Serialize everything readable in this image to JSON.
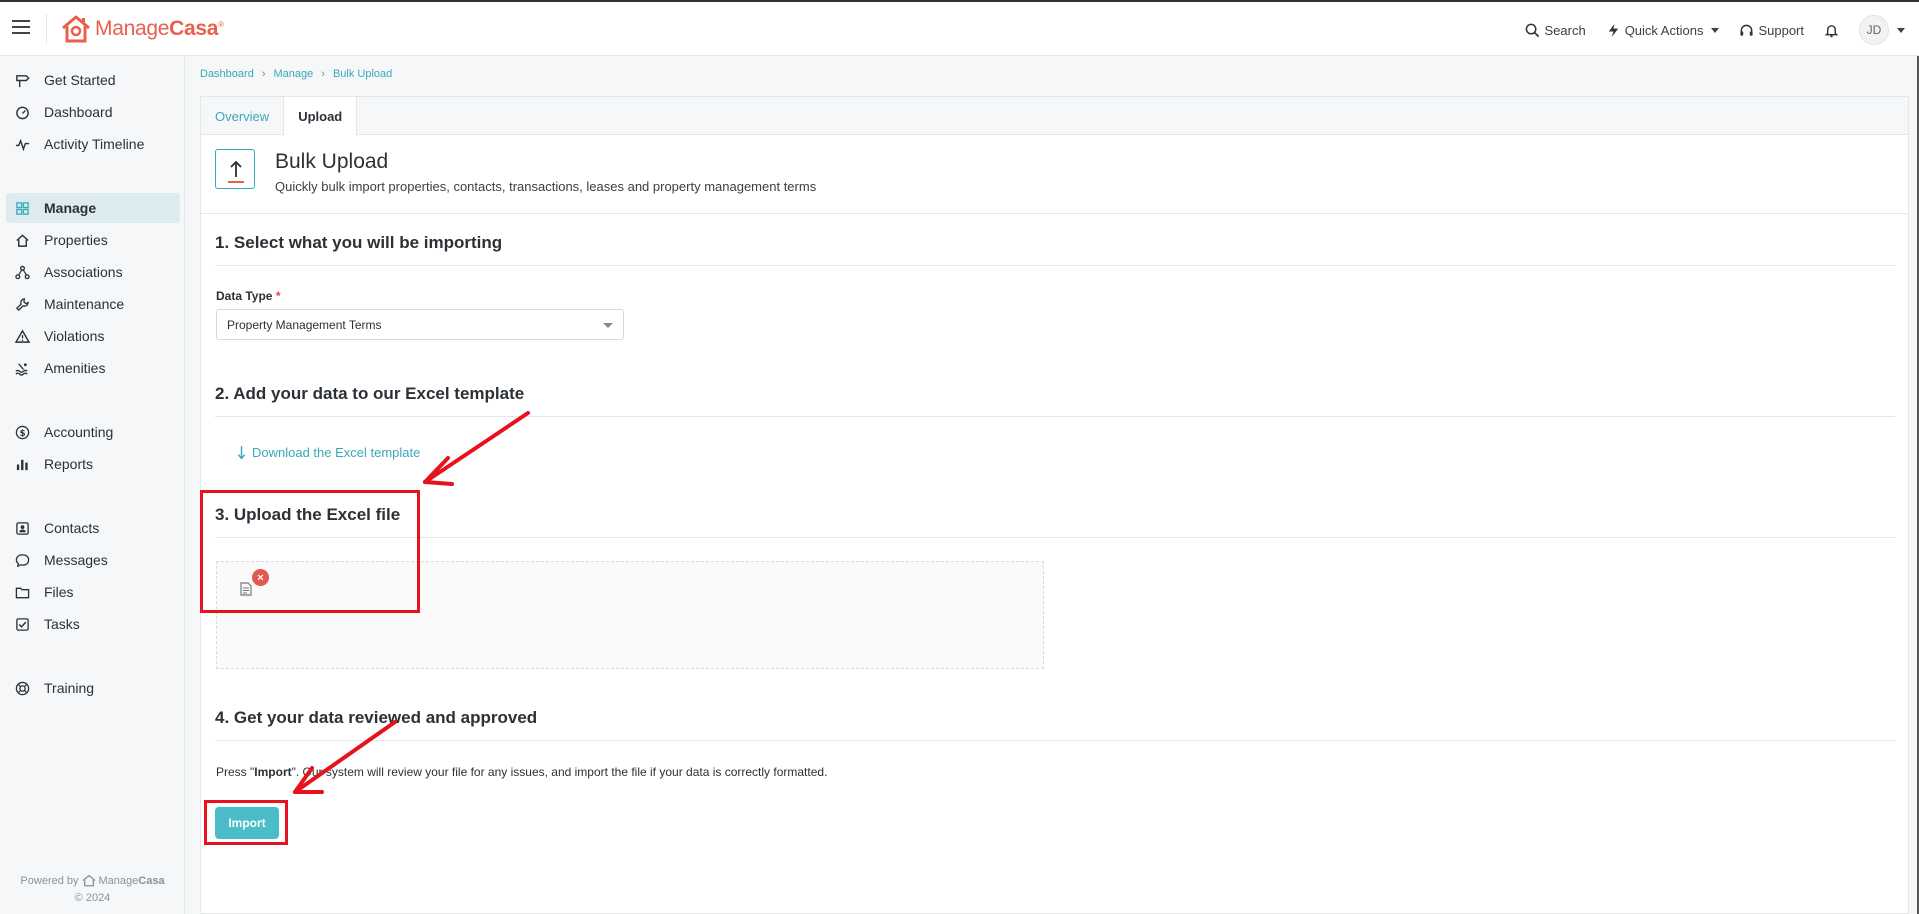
{
  "app": {
    "brand_light": "Manage",
    "brand_bold": "Casa",
    "brand_mark": "®"
  },
  "topbar": {
    "search": "Search",
    "quick_actions": "Quick Actions",
    "support": "Support",
    "avatar_initials": "JD"
  },
  "sidebar": {
    "items": [
      {
        "label": "Get Started",
        "icon": "signpost-icon"
      },
      {
        "label": "Dashboard",
        "icon": "gauge-icon"
      },
      {
        "label": "Activity Timeline",
        "icon": "pulse-icon"
      },
      {
        "label": "Manage",
        "icon": "grid-icon",
        "active": true
      },
      {
        "label": "Properties",
        "icon": "house-icon"
      },
      {
        "label": "Associations",
        "icon": "network-icon"
      },
      {
        "label": "Maintenance",
        "icon": "wrench-icon"
      },
      {
        "label": "Violations",
        "icon": "warning-icon"
      },
      {
        "label": "Amenities",
        "icon": "pool-icon"
      },
      {
        "label": "Accounting",
        "icon": "dollar-icon"
      },
      {
        "label": "Reports",
        "icon": "bar-chart-icon"
      },
      {
        "label": "Contacts",
        "icon": "contact-card-icon"
      },
      {
        "label": "Messages",
        "icon": "chat-icon"
      },
      {
        "label": "Files",
        "icon": "folder-icon"
      },
      {
        "label": "Tasks",
        "icon": "checkbox-icon"
      },
      {
        "label": "Training",
        "icon": "lifebuoy-icon"
      }
    ],
    "powered_by": "Powered by",
    "powered_brand_light": "Manage",
    "powered_brand_bold": "Casa",
    "copyright": "© 2024"
  },
  "breadcrumb": [
    "Dashboard",
    "Manage",
    "Bulk Upload"
  ],
  "tabs": [
    {
      "label": "Overview",
      "active": false
    },
    {
      "label": "Upload",
      "active": true
    }
  ],
  "header": {
    "title": "Bulk Upload",
    "subtitle": "Quickly bulk import properties, contacts, transactions, leases and property management terms"
  },
  "steps": {
    "s1": "1. Select what you will be importing",
    "s2": "2. Add your data to our Excel template",
    "s3": "3. Upload the Excel file",
    "s4": "4. Get your data reviewed and approved"
  },
  "form": {
    "data_type_label": "Data Type",
    "required_mark": "*",
    "data_type_value": "Property Management Terms"
  },
  "download_link": "Download the Excel template",
  "upload": {
    "remove_glyph": "×"
  },
  "import_note": {
    "pre": "Press \"",
    "bold": "Import",
    "post": "\". Our system will review your file for any issues, and import the file if your data is correctly formatted."
  },
  "import_button": "Import",
  "colors": {
    "accent": "#3aa8b8",
    "brand": "#e8604c",
    "annotation": "#e8121e",
    "button": "#4bbdc9"
  }
}
